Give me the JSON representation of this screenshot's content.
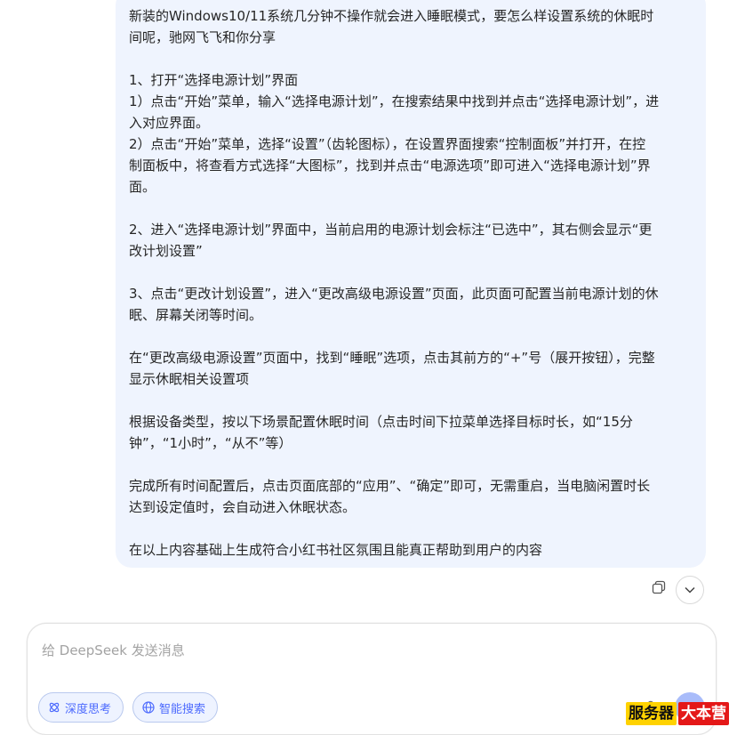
{
  "message": {
    "lines": [
      "新装的Windows10/11系统几分钟不操作就会进入睡眠模式，要怎么样设置系统的休眠时",
      "间呢，驰网飞飞和你分享",
      "",
      "1、打开“选择电源计划”界面",
      "1）点击“开始”菜单，输入“选择电源计划”，在搜索结果中找到并点击“选择电源计划”，进",
      "入对应界面。",
      "2）点击“开始”菜单，选择“设置”（齿轮图标），在设置界面搜索“控制面板”并打开，在控",
      "制面板中，将查看方式选择“大图标”，找到并点击“电源选项”即可进入“选择电源计划”界",
      "面。",
      "",
      "2、进入“选择电源计划”界面中，当前启用的电源计划会标注“已选中”，其右侧会显示“更",
      "改计划设置”",
      "",
      "3、点击“更改计划设置”，进入“更改高级电源设置”页面，此页面可配置当前电源计划的休",
      "眠、屏幕关闭等时间。",
      "",
      "在“更改高级电源设置”页面中，找到“睡眠”选项，点击其前方的“+”号（展开按钮），完整",
      "显示休眠相关设置项",
      "",
      "根据设备类型，按以下场景配置休眠时间（点击时间下拉菜单选择目标时长，如“15分",
      "钟”，“1小时”，“从不”等）",
      "",
      "完成所有时间配置后，点击页面底部的“应用”、“确定”即可，无需重启，当电脑闲置时长",
      "达到设定值时，会自动进入休眠状态。",
      "",
      "在以上内容基础上生成符合小红书社区氛围且能真正帮助到用户的内容"
    ]
  },
  "composer": {
    "placeholder": "给 DeepSeek 发送消息",
    "deep_think_label": "深度思考",
    "web_search_label": "智能搜索"
  },
  "watermark": {
    "part1": "服务器",
    "part2": "大本营"
  },
  "colors": {
    "bubble": "#eff4fe",
    "accent": "#4d6bfe",
    "send": "#a9bcfa"
  }
}
